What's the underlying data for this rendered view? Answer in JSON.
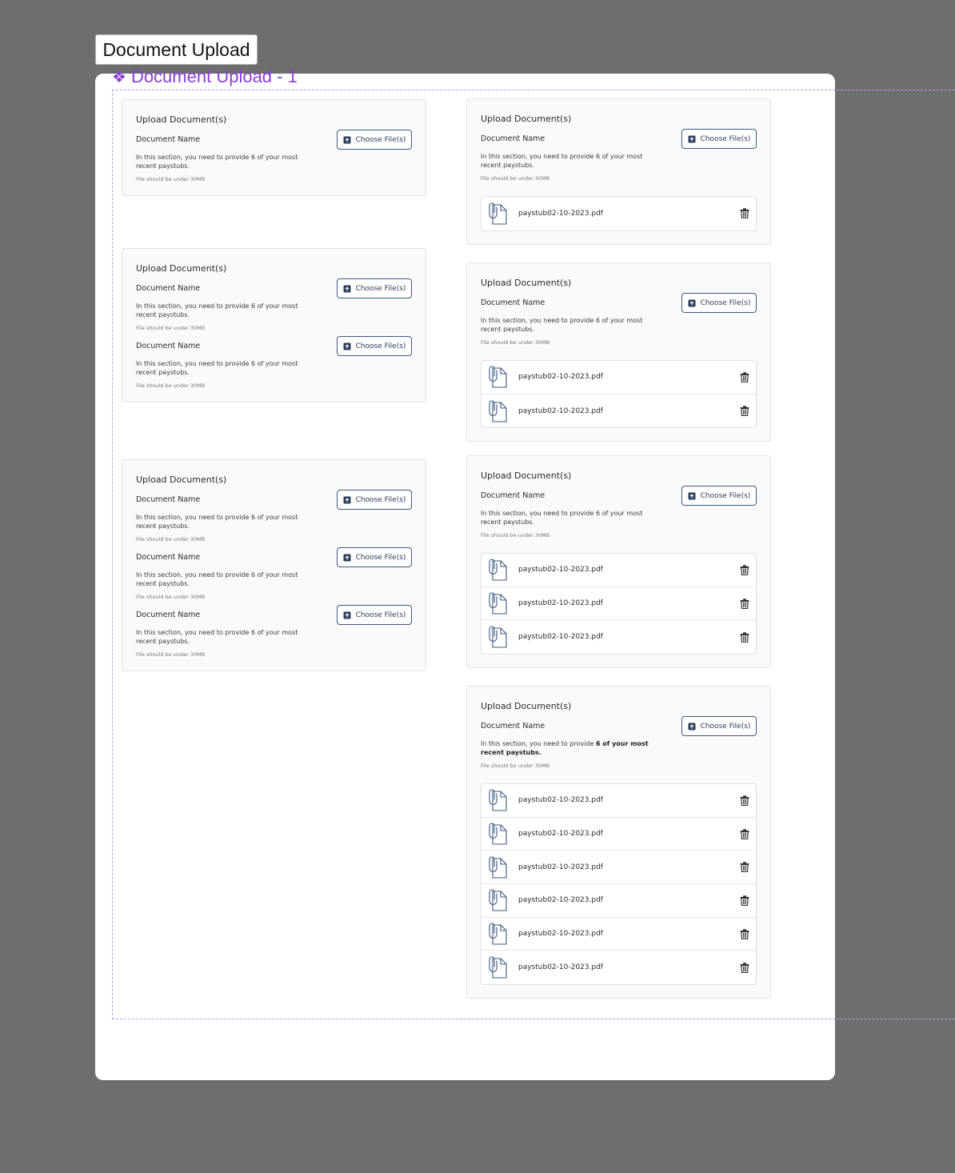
{
  "frame_tab": "Document Upload",
  "component_label": "Document Upload - 1",
  "component_icon": "component-diamond-icon",
  "colors": {
    "accent": "#8a3fd6",
    "button_border": "#3d5a80",
    "background": "#6e6e6e"
  },
  "card_title": "Upload Document(s)",
  "doc_name": "Document Name",
  "description": "In this section, you need to provide 6 of your most recent paystubs.",
  "description_rich": {
    "prefix": "In this section, you need to provide ",
    "bold": "6 of your most recent paystubs."
  },
  "file_note": "File should be under 30MB",
  "choose_label": "Choose File(s)",
  "file_name": "paystub02-10-2023.pdf",
  "icons": {
    "upload": "upload-icon",
    "file": "paperclip-file-icon",
    "delete": "trash-icon"
  },
  "cards": [
    {
      "id": "l1",
      "column": "left",
      "sections": 1,
      "files": 0
    },
    {
      "id": "l2",
      "column": "left",
      "sections": 2,
      "files": 0
    },
    {
      "id": "l3",
      "column": "left",
      "sections": 3,
      "files": 0
    },
    {
      "id": "r1",
      "column": "right",
      "sections": 1,
      "files": 1
    },
    {
      "id": "r2",
      "column": "right",
      "sections": 1,
      "files": 2
    },
    {
      "id": "r3",
      "column": "right",
      "sections": 1,
      "files": 3
    },
    {
      "id": "r4",
      "column": "right",
      "sections": 1,
      "files": 6,
      "bold_description": true
    }
  ]
}
